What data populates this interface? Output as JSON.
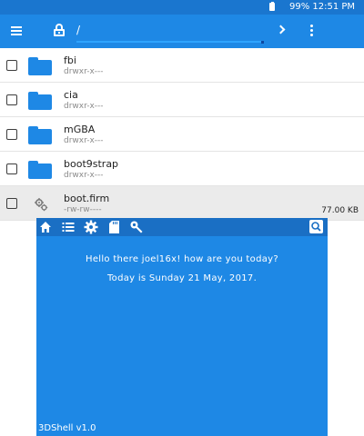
{
  "status_bar": {
    "battery_icon": "battery-icon",
    "text": "99% 12:51 PM"
  },
  "toolbar": {
    "menu_icon": "menu-icon",
    "lock_icon": "lock-icon",
    "path": "/",
    "forward_icon": "chevron-right-icon",
    "more_icon": "more-vert-icon"
  },
  "files": [
    {
      "name": "fbi",
      "perms": "drwxr-x---",
      "size": "",
      "icon": "folder-icon"
    },
    {
      "name": "cia",
      "perms": "drwxr-x---",
      "size": "",
      "icon": "folder-icon"
    },
    {
      "name": "mGBA",
      "perms": "drwxr-x---",
      "size": "",
      "icon": "folder-icon"
    },
    {
      "name": "boot9strap",
      "perms": "drwxr-x---",
      "size": "",
      "icon": "folder-icon"
    },
    {
      "name": "boot.firm",
      "perms": "-rw-rw----",
      "size": "77.00 KB",
      "icon": "gears-icon"
    }
  ],
  "shell": {
    "icons": [
      "home-icon",
      "list-icon",
      "gear-icon",
      "sdcard-icon",
      "wrench-icon",
      "search-icon"
    ],
    "greeting": "Hello there joel16x! how are you today?",
    "date_line": "Today is Sunday 21 May, 2017.",
    "version": "3DShell v1.0"
  },
  "colors": {
    "status_bar": "#1a76cf",
    "toolbar": "#1e88e5",
    "accent": "#1e88e5",
    "bottom_bg": "#1e88e5",
    "bottom_toolbar": "#1a6fc4",
    "selected_row": "#ebebeb"
  }
}
